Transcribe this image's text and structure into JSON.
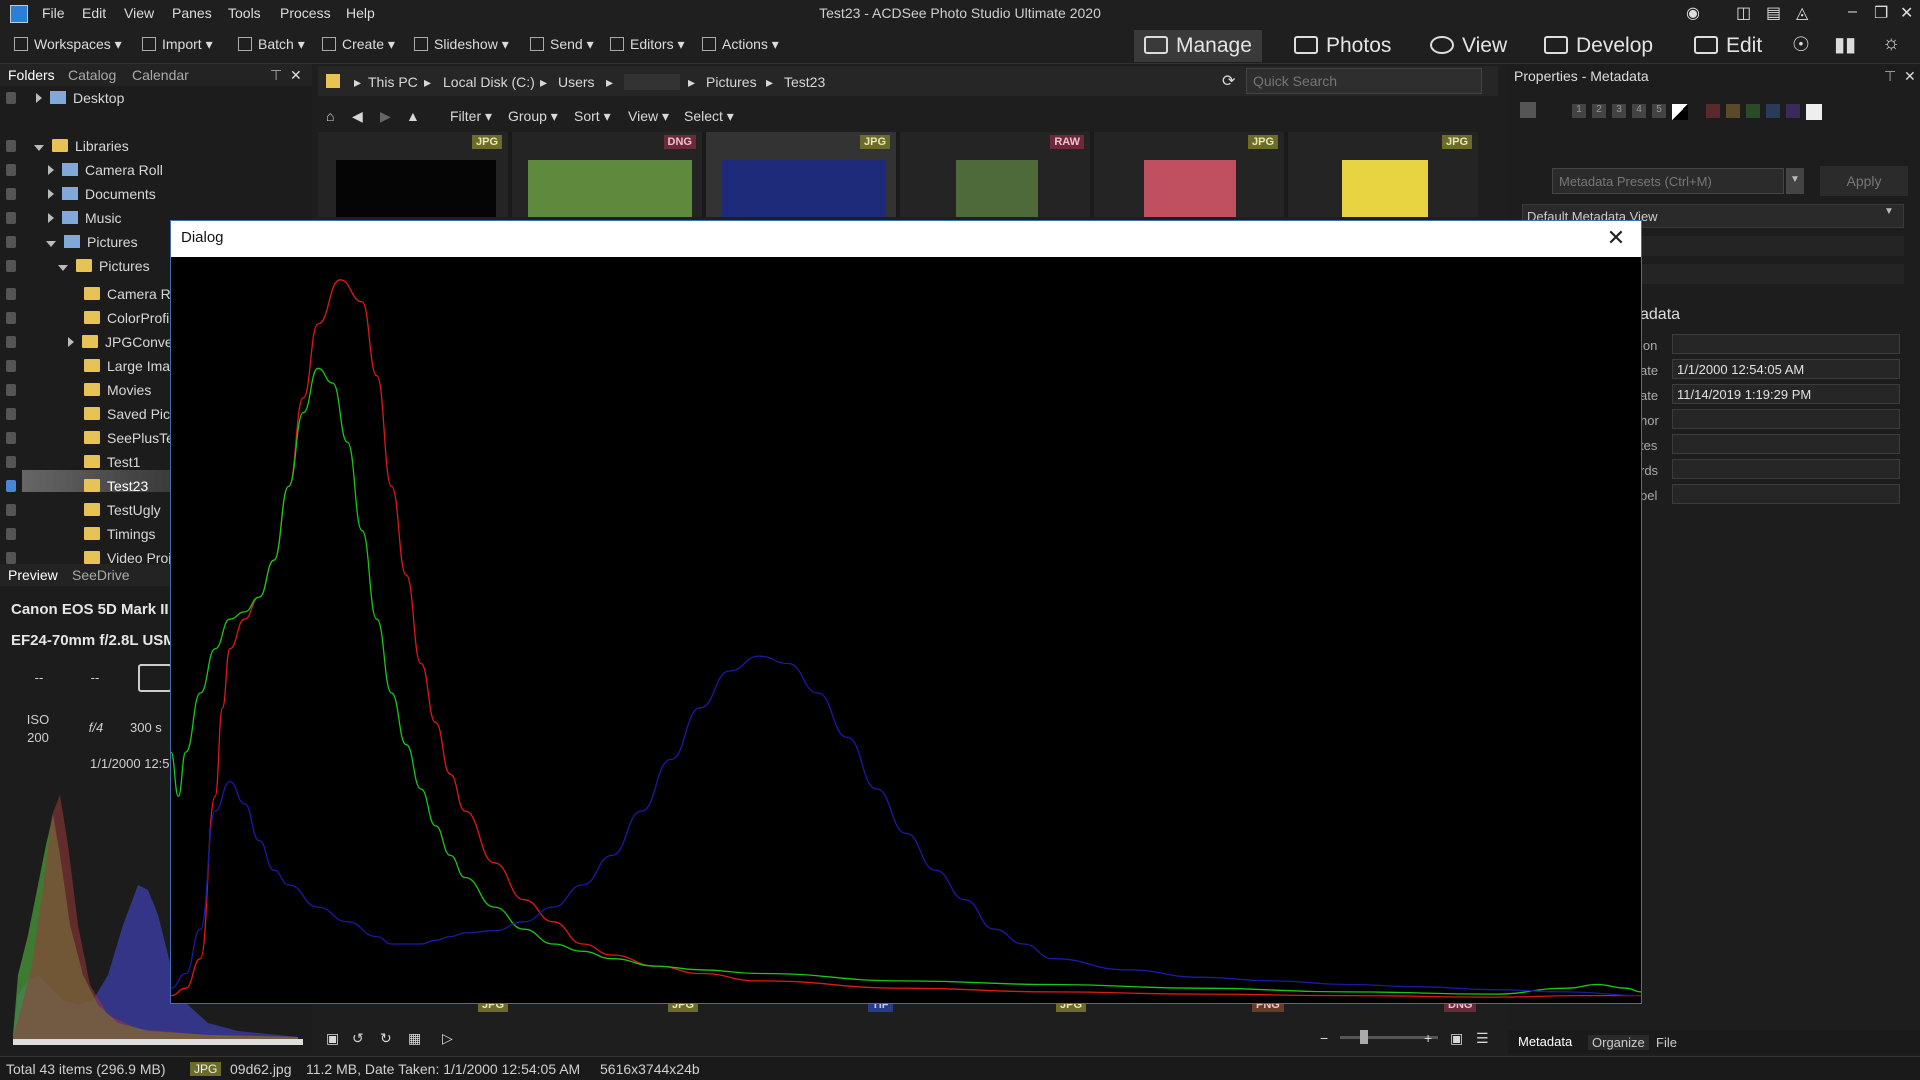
{
  "window": {
    "title": "Test23 - ACDSee Photo Studio Ultimate 2020",
    "menu": [
      "File",
      "Edit",
      "View",
      "Panes",
      "Tools",
      "Process",
      "Help"
    ]
  },
  "toolbar": {
    "items": [
      "Workspaces",
      "Import",
      "Batch",
      "Create",
      "Slideshow",
      "Send",
      "Editors",
      "Actions"
    ],
    "modes": [
      "Manage",
      "Photos",
      "View",
      "Develop",
      "Edit"
    ]
  },
  "left_panel": {
    "tabs": [
      "Folders",
      "Catalog",
      "Calendar"
    ],
    "tree": {
      "desktop": "Desktop",
      "libraries": "Libraries",
      "camera_roll": "Camera Roll",
      "documents": "Documents",
      "music": "Music",
      "pictures": "Pictures",
      "pictures_sub": "Pictures",
      "folders": [
        "Camera Ro",
        "ColorProfil",
        "JPGConve",
        "Large Imag",
        "Movies",
        "Saved Pic",
        "SeePlusTe",
        "Test1",
        "Test23",
        "TestUgly",
        "Timings",
        "Video Proj"
      ]
    },
    "bottom_tabs": [
      "Preview",
      "SeeDrive"
    ],
    "camera": "Canon EOS 5D Mark II",
    "lens": "EF24-70mm f/2.8L USM",
    "exif": {
      "dash1": "--",
      "dash2": "--",
      "iso_label": "ISO",
      "iso_value": "200",
      "aperture": "f/4",
      "shutter": "300 s",
      "date": "1/1/2000 12:5"
    }
  },
  "browser": {
    "path": [
      "This PC",
      "Local Disk (C:)",
      "Users",
      "Pictures",
      "Test23"
    ],
    "quick_search_placeholder": "Quick Search",
    "filter_items": [
      "Filter",
      "Group",
      "Sort",
      "View",
      "Select"
    ],
    "thumb_badges": [
      "JPG",
      "DNG",
      "JPG",
      "RAW",
      "JPG",
      "JPG"
    ],
    "bottom_badges": [
      "JPG",
      "JPG",
      "TIF",
      "JPG",
      "PNG",
      "DNG"
    ]
  },
  "right_panel": {
    "title": "Properties - Metadata",
    "ratings": [
      "1",
      "2",
      "3",
      "4",
      "5"
    ],
    "preset_placeholder": "Metadata Presets (Ctrl+M)",
    "apply_label": "Apply",
    "view_select": "Default Metadata View",
    "section_title": "adata",
    "fields": [
      {
        "label": "ion",
        "value": ""
      },
      {
        "label": "ate",
        "value": "1/1/2000 12:54:05 AM"
      },
      {
        "label": "ate",
        "value": "11/14/2019 1:19:29 PM"
      },
      {
        "label": "hor",
        "value": ""
      },
      {
        "label": "tes",
        "value": ""
      },
      {
        "label": "rds",
        "value": ""
      },
      {
        "label": "bel",
        "value": ""
      }
    ],
    "bottom_tabs": [
      "Metadata",
      "Organize",
      "File"
    ]
  },
  "status": {
    "total": "Total 43 items  (296.9 MB)",
    "type_badge": "JPG",
    "filename": "09d62.jpg",
    "info": "11.2 MB, Date Taken: 1/1/2000 12:54:05 AM",
    "dims": "5616x3744x24b"
  },
  "dialog": {
    "title": "Dialog",
    "close_glyph": "✕"
  },
  "colors": {
    "red": "#e01818",
    "green": "#18c818",
    "blue": "#1a1aa8",
    "accent": "#3e6fb0"
  },
  "histogram": {
    "x_max": 100,
    "y_max": 100,
    "red": [
      [
        0,
        1
      ],
      [
        1,
        2
      ],
      [
        2,
        6
      ],
      [
        3,
        28
      ],
      [
        3.5,
        40
      ],
      [
        4,
        48
      ],
      [
        5,
        52
      ],
      [
        6,
        55
      ],
      [
        7,
        60
      ],
      [
        8,
        70
      ],
      [
        9,
        82
      ],
      [
        10,
        92
      ],
      [
        11.5,
        98
      ],
      [
        13,
        95
      ],
      [
        14,
        85
      ],
      [
        15,
        70
      ],
      [
        16,
        58
      ],
      [
        17,
        46
      ],
      [
        18,
        38
      ],
      [
        19,
        31
      ],
      [
        20,
        26
      ],
      [
        22,
        19
      ],
      [
        24,
        14
      ],
      [
        26,
        11
      ],
      [
        28,
        8
      ],
      [
        30,
        6.5
      ],
      [
        33,
        5
      ],
      [
        36,
        4
      ],
      [
        40,
        3
      ],
      [
        50,
        2
      ],
      [
        60,
        1.5
      ],
      [
        70,
        1.2
      ],
      [
        80,
        1
      ],
      [
        90,
        0.8
      ],
      [
        96,
        1
      ],
      [
        100,
        1
      ]
    ],
    "green": [
      [
        0,
        34
      ],
      [
        0.5,
        28
      ],
      [
        1,
        34
      ],
      [
        2,
        42
      ],
      [
        3,
        48
      ],
      [
        4,
        52
      ],
      [
        5,
        53
      ],
      [
        6,
        55
      ],
      [
        7,
        60
      ],
      [
        8,
        70
      ],
      [
        9,
        80
      ],
      [
        10,
        86
      ],
      [
        11,
        84
      ],
      [
        12,
        76
      ],
      [
        13,
        64
      ],
      [
        14,
        52
      ],
      [
        15,
        42
      ],
      [
        16,
        35
      ],
      [
        17,
        29
      ],
      [
        18,
        24
      ],
      [
        19,
        20
      ],
      [
        20,
        17
      ],
      [
        22,
        13
      ],
      [
        24,
        10
      ],
      [
        26,
        8
      ],
      [
        28,
        7
      ],
      [
        30,
        6
      ],
      [
        33,
        5
      ],
      [
        36,
        4.5
      ],
      [
        40,
        4
      ],
      [
        50,
        3
      ],
      [
        60,
        2.5
      ],
      [
        70,
        2
      ],
      [
        80,
        1.5
      ],
      [
        90,
        1.2
      ],
      [
        95,
        2
      ],
      [
        97,
        2.5
      ],
      [
        99,
        2
      ],
      [
        100,
        1.5
      ]
    ],
    "blue": [
      [
        0,
        2
      ],
      [
        1,
        4
      ],
      [
        2,
        10
      ],
      [
        3,
        26
      ],
      [
        4,
        30
      ],
      [
        5,
        27
      ],
      [
        6,
        22
      ],
      [
        7,
        18
      ],
      [
        8,
        16
      ],
      [
        10,
        13
      ],
      [
        12,
        11
      ],
      [
        14,
        9
      ],
      [
        15,
        8
      ],
      [
        16,
        8
      ],
      [
        17,
        8
      ],
      [
        18,
        8.5
      ],
      [
        19,
        9
      ],
      [
        20,
        9.5
      ],
      [
        22,
        9.8
      ],
      [
        24,
        11
      ],
      [
        26,
        13
      ],
      [
        28,
        16
      ],
      [
        30,
        20
      ],
      [
        32,
        26
      ],
      [
        34,
        33
      ],
      [
        36,
        40
      ],
      [
        38,
        45
      ],
      [
        40,
        47
      ],
      [
        42,
        46
      ],
      [
        44,
        42
      ],
      [
        46,
        36
      ],
      [
        48,
        29
      ],
      [
        50,
        23
      ],
      [
        52,
        18
      ],
      [
        54,
        14
      ],
      [
        56,
        10
      ],
      [
        58,
        8
      ],
      [
        60,
        6
      ],
      [
        65,
        4.5
      ],
      [
        70,
        3.5
      ],
      [
        75,
        3
      ],
      [
        80,
        2.5
      ],
      [
        85,
        2.2
      ],
      [
        90,
        1.8
      ],
      [
        95,
        1.5
      ],
      [
        100,
        1
      ]
    ]
  }
}
